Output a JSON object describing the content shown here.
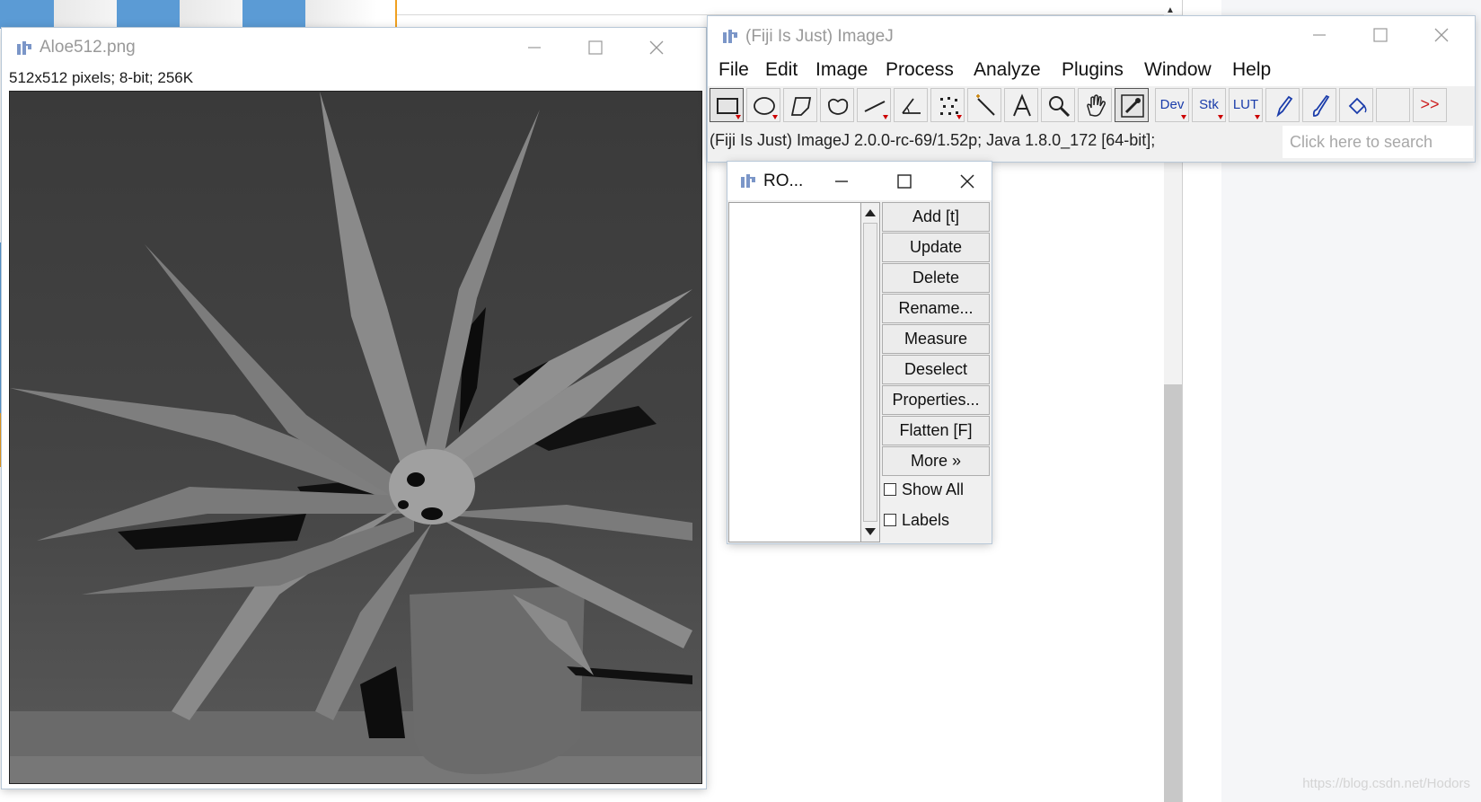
{
  "image_window": {
    "title": "Aloe512.png",
    "info": "512x512 pixels; 8-bit; 256K"
  },
  "main_window": {
    "title": "(Fiji Is Just) ImageJ",
    "menu": [
      "File",
      "Edit",
      "Image",
      "Process",
      "Analyze",
      "Plugins",
      "Window",
      "Help"
    ],
    "tool_labels": {
      "dev": "Dev",
      "stk": "Stk",
      "lut": "LUT",
      "more": ">>"
    },
    "status": "(Fiji Is Just) ImageJ 2.0.0-rc-69/1.52p; Java 1.8.0_172 [64-bit];",
    "search_placeholder": "Click here to search"
  },
  "roi_manager": {
    "title": "RO...",
    "buttons": [
      "Add [t]",
      "Update",
      "Delete",
      "Rename...",
      "Measure",
      "Deselect",
      "Properties...",
      "Flatten [F]",
      "More »"
    ],
    "checkboxes": [
      "Show All",
      "Labels"
    ]
  },
  "watermark": "https://blog.csdn.net/Hodors",
  "icons": {
    "app": "fiji-icon",
    "minimize": "minimize-icon",
    "maximize": "maximize-icon",
    "close": "close-icon"
  }
}
